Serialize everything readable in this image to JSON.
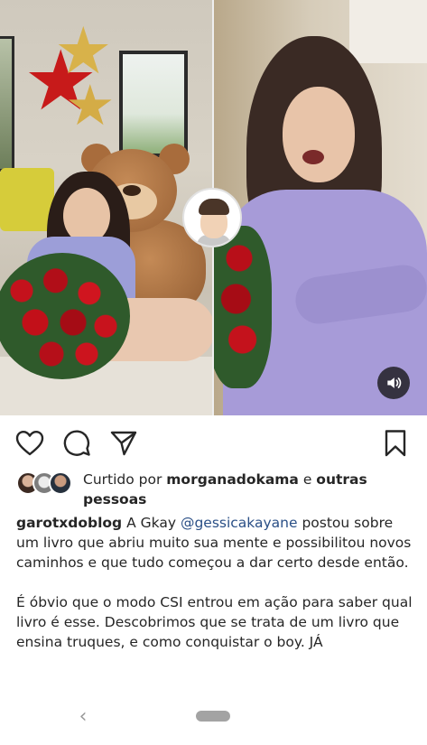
{
  "media": {
    "icons": {
      "avatar": "cartoon-man-avatar-icon",
      "volume": "volume-icon"
    }
  },
  "actions": {
    "icons": [
      "heart-icon",
      "comment-icon",
      "share-icon",
      "bookmark-icon"
    ]
  },
  "likes": {
    "prefix": "Curtido por ",
    "user": "morganadokama",
    "connector": " e ",
    "others": "outras pessoas"
  },
  "caption": {
    "author": "garotxdoblog",
    "text_before_mention": " A Gkay ",
    "mention": "@gessicakayane",
    "text_after_mention": " postou sobre um livro que abriu muito sua mente e possibilitou novos caminhos e que tudo começou a dar certo desde então.",
    "paragraph2": "É óbvio que o modo CSI entrou em ação para saber qual livro é esse. Descobrimos que se trata de um livro que ensina truques, e como conquistar o boy. JÁ"
  },
  "navbar": {
    "back_glyph": "‹"
  },
  "colors": {
    "mention": "#2a4f86",
    "text": "#262626",
    "nav_pill": "#a3a3a3"
  }
}
